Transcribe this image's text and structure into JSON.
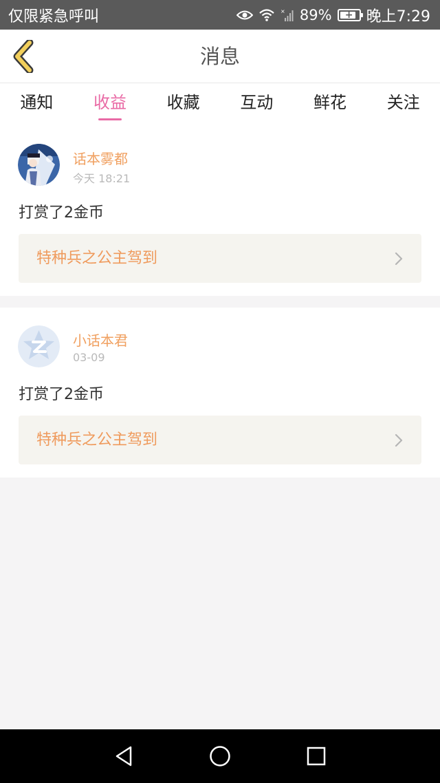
{
  "status_bar": {
    "carrier": "仅限紧急呼叫",
    "battery_percent": "89%",
    "battery_level": 0.89,
    "time": "晚上7:29",
    "icons": [
      "eye-comfort-icon",
      "wifi-icon",
      "signal-icon",
      "battery-icon"
    ]
  },
  "header": {
    "title": "消息",
    "back_icon": "chevron-left-icon",
    "accent_color": "#f2cf5b"
  },
  "tabs": [
    {
      "label": "通知",
      "active": false
    },
    {
      "label": "收益",
      "active": true
    },
    {
      "label": "收藏",
      "active": false
    },
    {
      "label": "互动",
      "active": false
    },
    {
      "label": "鲜花",
      "active": false
    },
    {
      "label": "关注",
      "active": false
    }
  ],
  "messages": [
    {
      "username": "话本雾都",
      "time": "今天 18:21",
      "text": "打赏了2金币",
      "book_title": "特种兵之公主驾到",
      "avatar": "anime-character-avatar"
    },
    {
      "username": "小话本君",
      "time": "03-09",
      "text": "打赏了2金币",
      "book_title": "特种兵之公主驾到",
      "avatar": "default-z-avatar"
    }
  ],
  "nav_bar": {
    "icons": [
      "back-triangle-icon",
      "home-circle-icon",
      "recents-square-icon"
    ]
  },
  "colors": {
    "tab_active": "#e96aa5",
    "username": "#f0a060",
    "book_title": "#ef9a5c",
    "book_bg": "#f5f4ef"
  }
}
